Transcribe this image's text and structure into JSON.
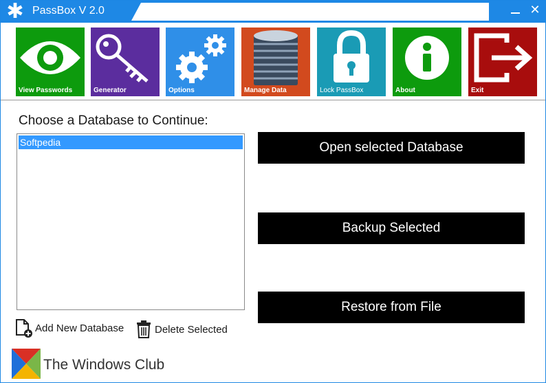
{
  "window": {
    "title": "PassBox V 2.0",
    "app_icon": "asterisk-icon",
    "accent": "#1e88e5"
  },
  "toolbar": {
    "tiles": [
      {
        "label": "View Passwords",
        "icon": "eye-icon",
        "color": "#0d9b0d"
      },
      {
        "label": "Generator",
        "icon": "key-icon",
        "color": "#5b2d9e"
      },
      {
        "label": "Options",
        "icon": "gears-icon",
        "color": "#2f8fe8"
      },
      {
        "label": "Manage Data",
        "icon": "database-icon",
        "color": "#d24a1e"
      },
      {
        "label": "Lock PassBox",
        "icon": "padlock-icon",
        "color": "#1a9bb5"
      },
      {
        "label": "About",
        "icon": "info-icon",
        "color": "#0d9b0d"
      },
      {
        "label": "Exit",
        "icon": "exit-icon",
        "color": "#a80d0d"
      }
    ]
  },
  "main": {
    "choose_label": "Choose a Database to Continue:",
    "databases": [
      "Softpedia"
    ],
    "selected_index": 0,
    "buttons": {
      "open": "Open selected Database",
      "backup": "Backup Selected",
      "restore": "Restore from File"
    },
    "add_database": "Add New Database",
    "delete_selected": "Delete Selected"
  },
  "brand": {
    "text": "The Windows Club"
  }
}
